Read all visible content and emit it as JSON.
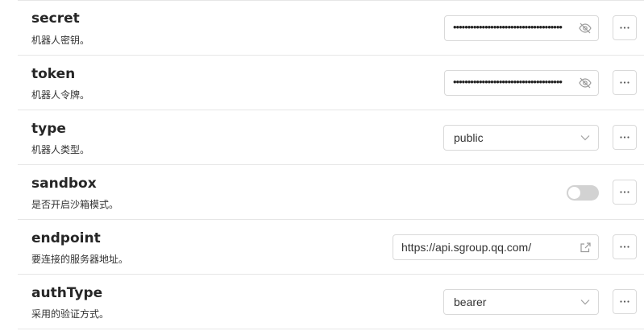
{
  "settings": [
    {
      "key": "secret",
      "name": "secret",
      "description": "机器人密钥。",
      "control": "password",
      "masked_value": "••••••••••••••••••••••••••••••••••••••",
      "icon": "eye-off-icon"
    },
    {
      "key": "token",
      "name": "token",
      "description": "机器人令牌。",
      "control": "password",
      "masked_value": "••••••••••••••••••••••••••••••••••••••",
      "icon": "eye-off-icon"
    },
    {
      "key": "type",
      "name": "type",
      "description": "机器人类型。",
      "control": "select",
      "value": "public"
    },
    {
      "key": "sandbox",
      "name": "sandbox",
      "description": "是否开启沙箱模式。",
      "control": "toggle",
      "checked": false
    },
    {
      "key": "endpoint",
      "name": "endpoint",
      "description": "要连接的服务器地址。",
      "control": "url",
      "value": "https://api.sgroup.qq.com/",
      "icon": "external-link-icon"
    },
    {
      "key": "authType",
      "name": "authType",
      "description": "采用的验证方式。",
      "control": "select",
      "value": "bearer"
    }
  ],
  "more_icon": "more-horizontal-icon",
  "colors": {
    "border": "#d9d9d9",
    "divider": "#e6e6e6",
    "toggle_off": "#d2d2d2",
    "icon": "#9a9a9a"
  }
}
